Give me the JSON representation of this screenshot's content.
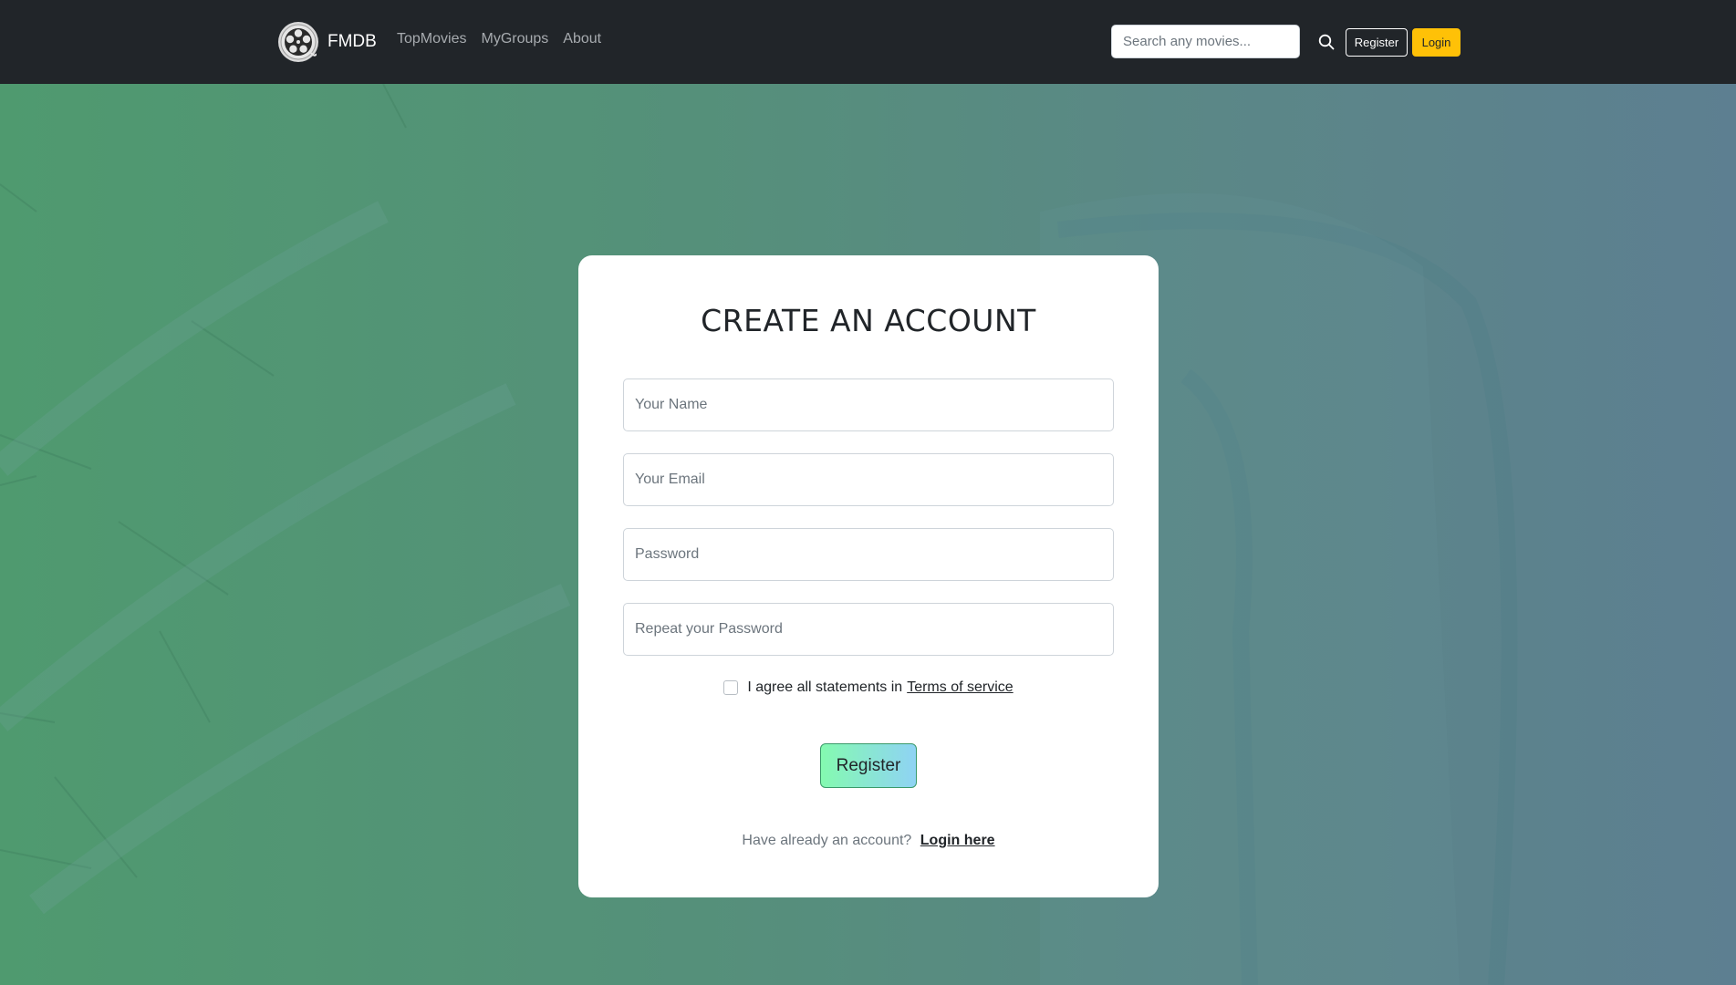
{
  "navbar": {
    "brand": "FMDB",
    "links": [
      {
        "label": "TopMovies"
      },
      {
        "label": "MyGroups"
      },
      {
        "label": "About"
      }
    ],
    "search": {
      "placeholder": "Search any movies...",
      "value": ""
    },
    "register_label": "Register",
    "login_label": "Login"
  },
  "form": {
    "title": "CREATE AN ACCOUNT",
    "name_placeholder": "Your Name",
    "email_placeholder": "Your Email",
    "password_placeholder": "Password",
    "repeat_placeholder": "Repeat your Password",
    "agree_text": "I agree all statements in",
    "terms_label": "Terms of service",
    "agree_checked": false,
    "submit_label": "Register",
    "login_prompt": "Have already an account?",
    "login_link": "Login here"
  },
  "colors": {
    "navbar_bg": "#212529",
    "login_accent": "#ffc107",
    "button_gradient_start": "#84fab0",
    "button_gradient_end": "#8fd3f4"
  },
  "icons": {
    "brand": "film-reel-icon",
    "search": "search-icon"
  }
}
